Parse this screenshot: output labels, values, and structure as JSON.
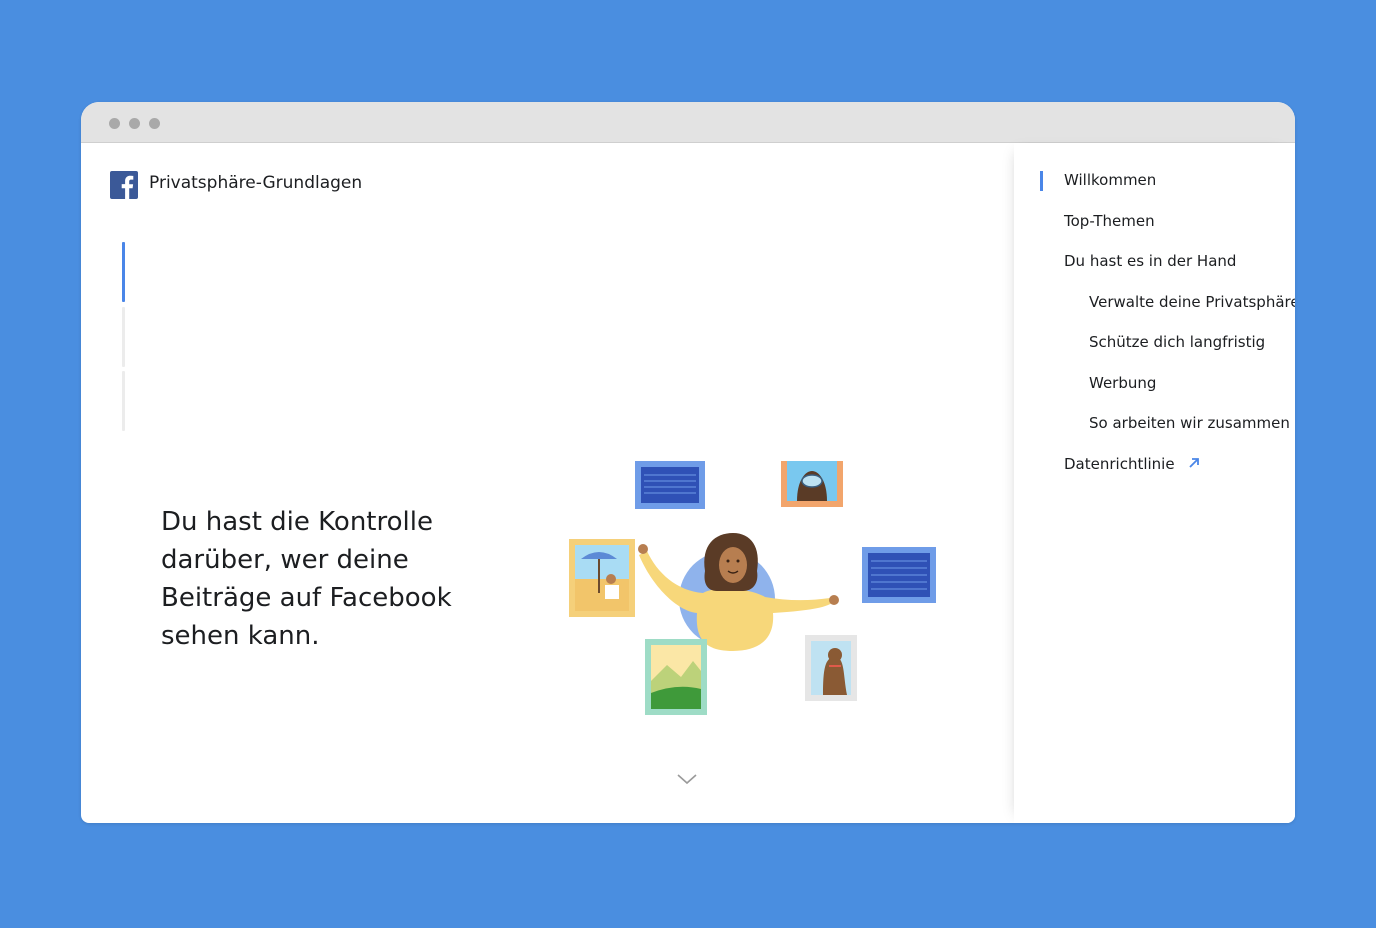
{
  "app": {
    "title": "Privatsphäre-Grundlagen",
    "brand_color": "#3b5998",
    "accent_color": "#4a86e8"
  },
  "headline": "Du hast die Kontrolle\ndarüber, wer deine\nBeiträge auf Facebook\nsehen kann.",
  "progress": {
    "total_steps": 3,
    "current_step": 1
  },
  "nav": {
    "items": [
      {
        "label": "Willkommen",
        "active": true
      },
      {
        "label": "Top-Themen"
      },
      {
        "label": "Du hast es in der Hand"
      },
      {
        "label": "Verwalte deine Privatsphäre",
        "sub": true
      },
      {
        "label": "Schütze dich langfristig",
        "sub": true
      },
      {
        "label": "Werbung",
        "sub": true
      },
      {
        "label": "So arbeiten wir zusammen",
        "sub": true
      },
      {
        "label": "Datenrichtlinie",
        "external": true
      }
    ]
  },
  "icons": {
    "logo": "facebook-logo-icon",
    "scroll": "chevron-down-icon",
    "external": "external-link-arrow-icon"
  }
}
